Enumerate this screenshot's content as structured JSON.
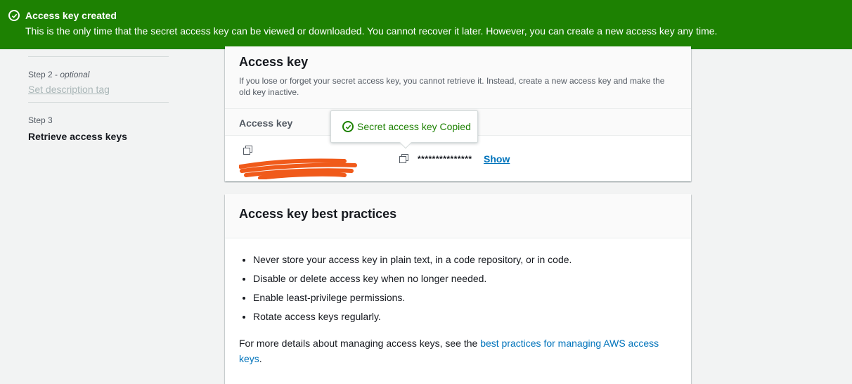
{
  "banner": {
    "title": "Access key created",
    "message": "This is the only time that the secret access key can be viewed or downloaded. You cannot recover it later. However, you can create a new access key any time.",
    "color": "#1d8102"
  },
  "steps": {
    "step2_label": "Step 2",
    "step2_optional": "optional",
    "step2_name": "Set description tag",
    "step3_label": "Step 3",
    "step3_name": "Retrieve access keys"
  },
  "access_key": {
    "heading": "Access key",
    "description": "If you lose or forget your secret access key, you cannot retrieve it. Instead, create a new access key and make the old key inactive.",
    "column_header": "Access key",
    "secret_masked": "***************",
    "show_label": "Show"
  },
  "popover": {
    "text": "Secret access key Copied"
  },
  "best_practices": {
    "heading": "Access key best practices",
    "items": [
      "Never store your access key in plain text, in a code repository, or in code.",
      "Disable or delete access key when no longer needed.",
      "Enable least-privilege permissions.",
      "Rotate access keys regularly."
    ],
    "more_prefix": "For more details about managing access keys, see the ",
    "more_link": "best practices for managing AWS access keys",
    "more_suffix": "."
  },
  "icons": [
    "check-circle-icon",
    "copy-icon"
  ]
}
